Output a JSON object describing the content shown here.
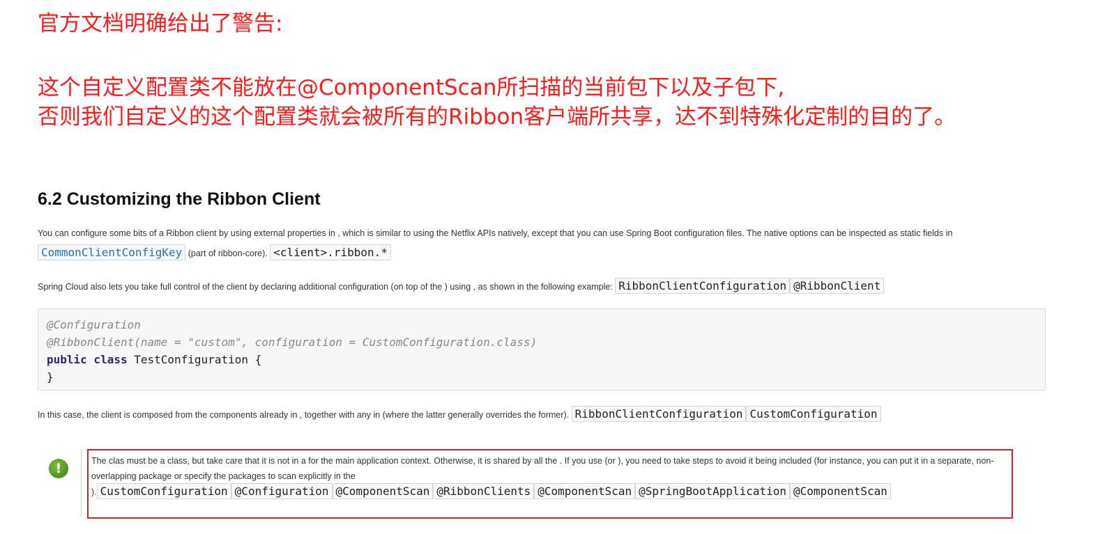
{
  "annotation_cn": {
    "title": "官方文档明确给出了警告:",
    "line1": "这个自定义配置类不能放在@ComponentScan所扫描的当前包下以及子包下,",
    "line2": "否则我们自定义的这个配置类就会被所有的Ribbon客户端所共享，达不到特殊化定制的目的了。"
  },
  "section": {
    "title": "6.2 Customizing the Ribbon Client"
  },
  "para1": {
    "text_a": "You can configure some bits of a Ribbon client by using external properties in , which is similar to using the Netflix APIs natively, except that you can use Spring Boot configuration files. The native options can be inspected as static fields in ",
    "code_link": "CommonClientConfigKey",
    "text_b": " (part of ribbon-core). ",
    "code_prop": "<client>.ribbon.*"
  },
  "para2": {
    "text": "Spring Cloud also lets you take full control of the client by declaring additional configuration (on top of the ) using , as shown in the following example: ",
    "code1": "RibbonClientConfiguration",
    "code2": "@RibbonClient"
  },
  "code_block": {
    "line1": "@Configuration",
    "line2": "@RibbonClient(name = \"custom\", configuration = CustomConfiguration.class)",
    "line3_kw": "public class",
    "line3_rest": " TestConfiguration {",
    "line4": "}"
  },
  "para3": {
    "text": "In this case, the client is composed from the components already in , together with any in (where the latter generally overrides the former). ",
    "code1": "RibbonClientConfiguration",
    "code2": "CustomConfiguration"
  },
  "warning": {
    "icon": "exclamation-icon",
    "icon_glyph": "!",
    "text": "The clas must be a class, but take care that it is not in a for the main application context. Otherwise, it is shared by all the . If you use (or ), you need to take steps to avoid it being included (for instance, you can put it in a separate, non-overlapping package or specify the packages to scan explicitly in the",
    "close": ").",
    "codes": [
      "CustomConfiguration",
      "@Configuration",
      "@ComponentScan",
      "@RibbonClients",
      "@ComponentScan",
      "@SpringBootApplication",
      "@ComponentScan"
    ],
    "highlight_color": "#e02020"
  },
  "colors": {
    "annotation_red": "#ff1a1a",
    "link_blue": "#2a6fb3"
  }
}
